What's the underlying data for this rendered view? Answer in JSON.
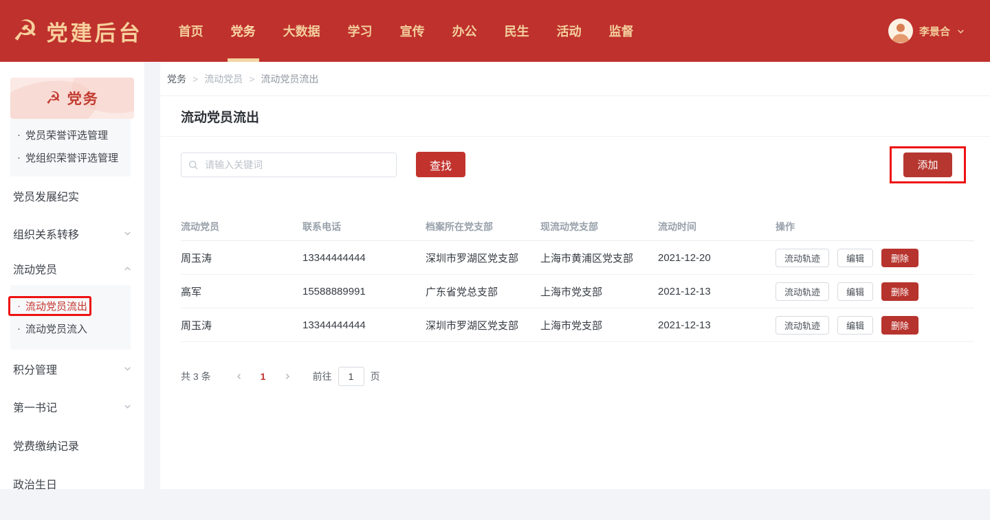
{
  "header": {
    "emblem": "☭",
    "app_title": "党建后台",
    "nav": [
      "首页",
      "党务",
      "大数据",
      "学习",
      "宣传",
      "办公",
      "民生",
      "活动",
      "监督"
    ],
    "active_nav": "党务",
    "user_name": "李景合"
  },
  "sidebar": {
    "banner_emblem": "☭",
    "banner_title": "党务",
    "bullet": "·",
    "honor_submenu": [
      "党员荣誉评选管理",
      "党组织荣誉评选管理"
    ],
    "items": [
      "党员发展纪实",
      "组织关系转移",
      "流动党员",
      "积分管理",
      "第一书记",
      "党费缴纳记录",
      "政治生日"
    ],
    "flow_submenu": [
      "流动党员流出",
      "流动党员流入"
    ],
    "active_submenu_item": "流动党员流出"
  },
  "breadcrumb": {
    "separator": ">",
    "items": [
      "党务",
      "流动党员",
      "流动党员流出"
    ]
  },
  "page": {
    "title": "流动党员流出"
  },
  "toolbar": {
    "search_placeholder": "请输入关键词",
    "search_button": "查找",
    "add_button": "添加"
  },
  "table": {
    "columns": [
      "流动党员",
      "联系电话",
      "档案所在党支部",
      "现流动党支部",
      "流动时间",
      "操作"
    ],
    "rows": [
      {
        "name": "周玉涛",
        "phone": "13344444444",
        "archive_branch": "深圳市罗湖区党支部",
        "current_branch": "上海市黄浦区党支部",
        "flow_date": "2021-12-20"
      },
      {
        "name": "高军",
        "phone": "15588889991",
        "archive_branch": "广东省党总支部",
        "current_branch": "上海市党支部",
        "flow_date": "2021-12-13"
      },
      {
        "name": "周玉涛",
        "phone": "13344444444",
        "archive_branch": "深圳市罗湖区党支部",
        "current_branch": "上海市党支部",
        "flow_date": "2021-12-13"
      }
    ],
    "actions": {
      "track": "流动轨迹",
      "edit": "编辑",
      "delete": "删除"
    }
  },
  "pagination": {
    "total": "共 3 条",
    "current_page": "1",
    "goto_label": "前往",
    "goto_value": "1",
    "page_unit": "页"
  },
  "colors": {
    "header_red": "#bf312d",
    "accent_red": "#c2332e",
    "annotation_red": "#ee1111"
  }
}
